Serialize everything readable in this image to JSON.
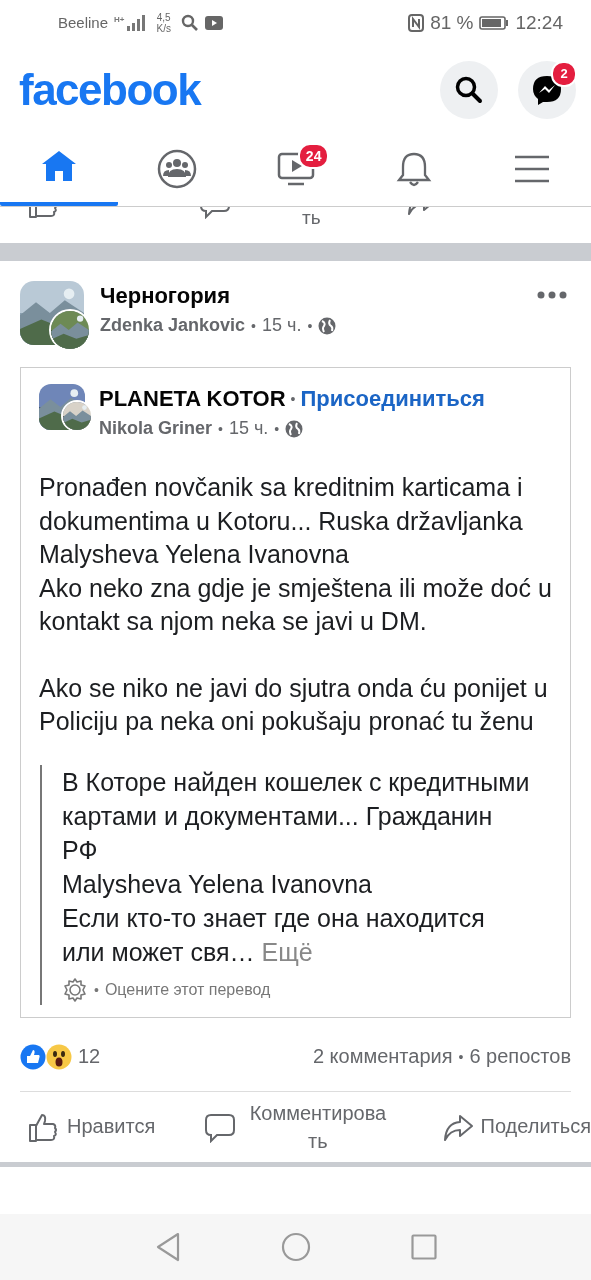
{
  "status_bar": {
    "carrier": "Beeline",
    "network": "H+",
    "speed_value": "4,5",
    "speed_unit": "K/s",
    "battery": "81 %",
    "time": "12:24"
  },
  "header": {
    "logo": "facebook",
    "messenger_badge": "2"
  },
  "tabs": [
    {
      "kind": "home",
      "selected": true
    },
    {
      "kind": "groups",
      "selected": false
    },
    {
      "kind": "watch",
      "selected": false,
      "badge": "24"
    },
    {
      "kind": "bell",
      "selected": false
    },
    {
      "kind": "menu",
      "selected": false
    }
  ],
  "previous_post_actions": {
    "comment_tail": "ть"
  },
  "post": {
    "group": "Черногория",
    "author": "Zdenka Jankovic",
    "separator": "•",
    "time": "15 ч.",
    "shared": {
      "page": "PLANETA KOTOR",
      "join": "Присоединиться",
      "author": "Nikola Griner",
      "time": "15 ч.",
      "text_blocks": [
        [
          "Pronađen novčanik sa kreditnim karticama i dokumentima u Kotoru... Ruska državljanka Malysheva Yelena Ivanovna",
          "Ako neko zna gdje je smještena ili može doć u kontakt sa njom neka se javi u DM."
        ],
        [
          "Ako se niko ne javi do sjutra onda ću ponijet u Policiju pa neka oni pokušaju pronać tu ženu"
        ]
      ],
      "translation": {
        "lines": [
          "В Которе найден кошелек с кредитными картами и документами... Гражданин РФ",
          "Malysheva Yelena Ivanovna",
          "Если кто-то знает где она находится или может свя…"
        ],
        "more": "Ещё",
        "rate": "Оцените этот перевод"
      }
    },
    "reactions_count": "12",
    "comments": "2 комментария",
    "shares": "6 репостов",
    "actions": [
      {
        "kind": "like",
        "label": "Нравится"
      },
      {
        "kind": "comment",
        "label": "Комментирова ть"
      },
      {
        "kind": "share",
        "label": "Поделиться"
      }
    ]
  }
}
